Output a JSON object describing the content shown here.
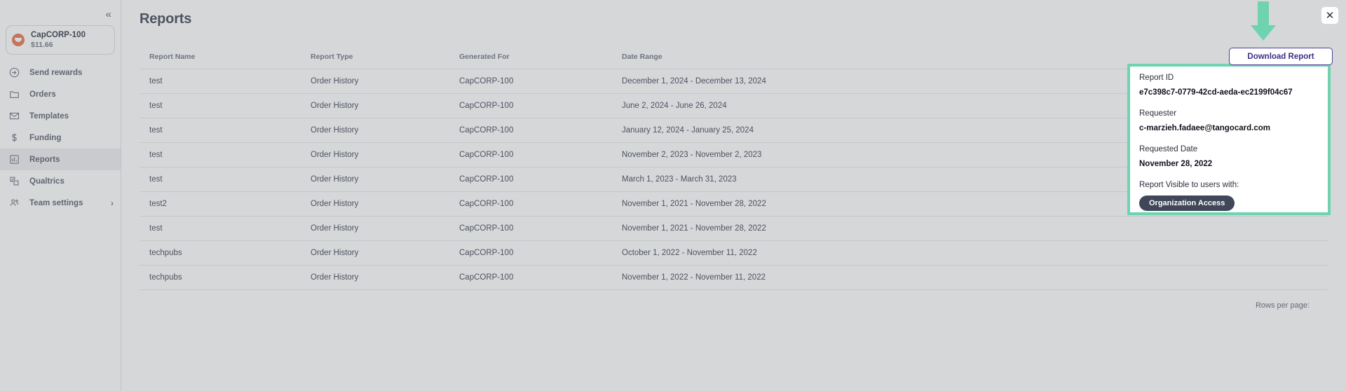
{
  "sidebar": {
    "collapse_label": "«",
    "account": {
      "name": "CapCORP-100",
      "balance": "$11.66",
      "icon": "org-avatar-icon"
    },
    "items": [
      {
        "label": "Send rewards",
        "icon": "send-icon",
        "active": false
      },
      {
        "label": "Orders",
        "icon": "folder-icon",
        "active": false
      },
      {
        "label": "Templates",
        "icon": "envelope-icon",
        "active": false
      },
      {
        "label": "Funding",
        "icon": "dollar-icon",
        "active": false
      },
      {
        "label": "Reports",
        "icon": "bar-chart-icon",
        "active": true
      },
      {
        "label": "Qualtrics",
        "icon": "layers-icon",
        "active": false
      },
      {
        "label": "Team settings",
        "icon": "users-icon",
        "active": false,
        "chevron": "›"
      }
    ]
  },
  "main": {
    "title": "Reports",
    "table": {
      "columns": [
        "Report Name",
        "Report Type",
        "Generated For",
        "Date Range"
      ],
      "rows": [
        [
          "test",
          "Order History",
          "CapCORP-100",
          "December 1, 2024 - December 13, 2024"
        ],
        [
          "test",
          "Order History",
          "CapCORP-100",
          "June 2, 2024 - June 26, 2024"
        ],
        [
          "test",
          "Order History",
          "CapCORP-100",
          "January 12, 2024 - January 25, 2024"
        ],
        [
          "test",
          "Order History",
          "CapCORP-100",
          "November 2, 2023 - November 2, 2023"
        ],
        [
          "test",
          "Order History",
          "CapCORP-100",
          "March 1, 2023 - March 31, 2023"
        ],
        [
          "test2",
          "Order History",
          "CapCORP-100",
          "November 1, 2021 - November 28, 2022"
        ],
        [
          "test",
          "Order History",
          "CapCORP-100",
          "November 1, 2021 - November 28, 2022"
        ],
        [
          "techpubs",
          "Order History",
          "CapCORP-100",
          "October 1, 2022 - November 11, 2022"
        ],
        [
          "techpubs",
          "Order History",
          "CapCORP-100",
          "November 1, 2022 - November 11, 2022"
        ]
      ]
    },
    "rows_per_page_label": "Rows per page:"
  },
  "modal": {
    "close_label": "✕",
    "download_label": "Download Report",
    "arrow_icon": "down-arrow-annotation",
    "fields": [
      {
        "label": "Report ID",
        "value": "e7c398c7-0779-42cd-aeda-ec2199f04c67"
      },
      {
        "label": "Requester",
        "value": "c-marzieh.fadaee@tangocard.com"
      },
      {
        "label": "Requested Date",
        "value": "November 28, 2022"
      }
    ],
    "visibility_label": "Report Visible to users with:",
    "visibility_chip": "Organization Access"
  },
  "colors": {
    "accent_green": "#6ed3ae",
    "purple": "#3d2f86",
    "chip_dark": "#3f4758",
    "orange": "#e8724b"
  }
}
